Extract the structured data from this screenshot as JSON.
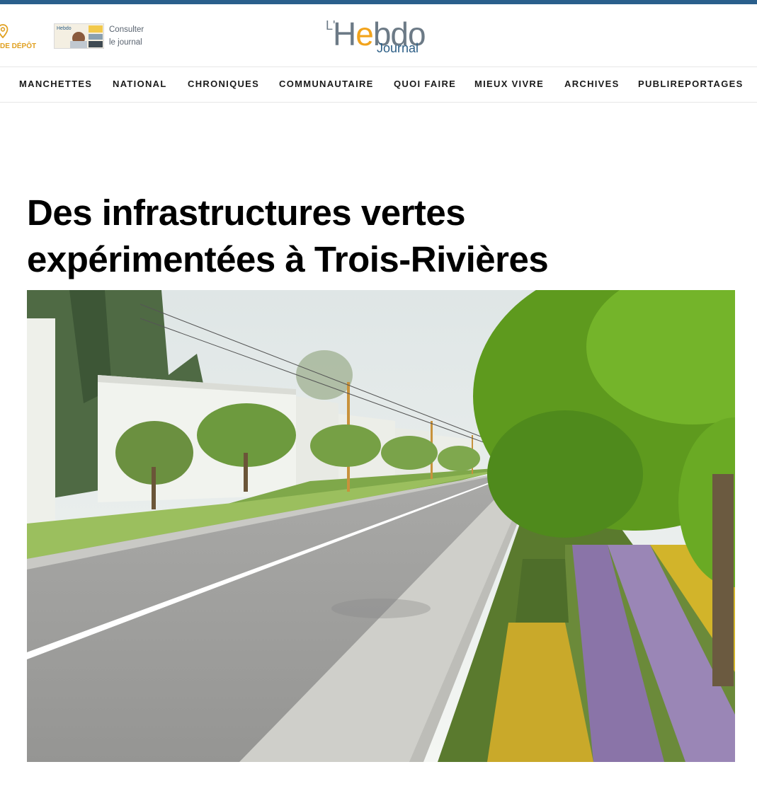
{
  "header": {
    "depot_label": "DE DÉPÔT",
    "journal_link_line1": "Consulter",
    "journal_link_line2": "le journal",
    "thumb_masthead": "Hebdo",
    "logo": {
      "prefix": "L'",
      "name_start": "H",
      "name_accent": "e",
      "name_end": "bdo",
      "sub": "Journal"
    }
  },
  "nav": {
    "items": [
      "MANCHETTES",
      "NATIONAL",
      "CHRONIQUES",
      "COMMUNAUTAIRE",
      "QUOI FAIRE",
      "MIEUX VIVRE",
      "ARCHIVES",
      "PUBLIREPORTAGES"
    ]
  },
  "article": {
    "title_line1": "Des infrastructures vertes",
    "title_line2": "expérimentées à Trois-Rivières"
  },
  "colors": {
    "topbar": "#2a5f8c",
    "accent_orange": "#f2a31b",
    "logo_grey": "#6c7a86",
    "logo_blue": "#2c5e86"
  },
  "icons": {
    "location": "location-pin-icon"
  }
}
